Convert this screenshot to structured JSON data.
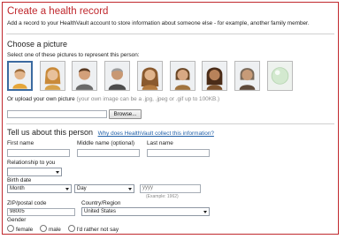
{
  "header": {
    "title": "Create a health record",
    "description": "Add a record to your HealthVault account to store information about someone else - for example, another family member."
  },
  "picture_section": {
    "heading": "Choose a picture",
    "instruction": "Select one of these pictures to represent this person:",
    "pictures": [
      {
        "icon": "avatar-boy-icon",
        "selected": true
      },
      {
        "icon": "avatar-girl-icon",
        "selected": false
      },
      {
        "icon": "avatar-man-icon",
        "selected": false
      },
      {
        "icon": "avatar-older-man-icon",
        "selected": false
      },
      {
        "icon": "avatar-woman-icon",
        "selected": false
      },
      {
        "icon": "avatar-woman-short-hair-icon",
        "selected": false
      },
      {
        "icon": "avatar-woman-dark-icon",
        "selected": false
      },
      {
        "icon": "avatar-older-woman-icon",
        "selected": false
      },
      {
        "icon": "avatar-blank-icon",
        "selected": false
      }
    ],
    "upload_label": "Or upload your own picture",
    "upload_hint": "(your own image can be a .jpg, .jpeg or .gif up to 100KB.)",
    "browse_label": "Browse..."
  },
  "person_section": {
    "heading": "Tell us about this person",
    "why_link": "Why does HealthVault collect this information?",
    "first_name_label": "First name",
    "middle_name_label": "Middle name (optional)",
    "last_name_label": "Last name",
    "relationship_label": "Relationship to you",
    "relationship_value": "",
    "birth_date_label": "Birth date",
    "month_value": "Month",
    "day_value": "Day",
    "year_placeholder": "yyyy",
    "year_example": "(Example: 1962)",
    "zip_label": "ZIP/postal code",
    "zip_value": "98005",
    "country_label": "Country/Region",
    "country_value": "United States",
    "gender_label": "Gender",
    "gender_options": [
      "female",
      "male",
      "I'd rather not say"
    ]
  },
  "colors": {
    "accent": "#c0282d",
    "link": "#1f5fa8",
    "hint": "#8a8a8a"
  }
}
